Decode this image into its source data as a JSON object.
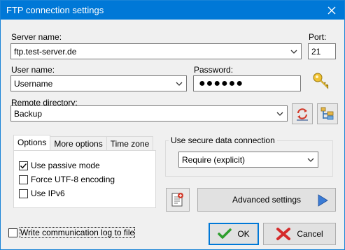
{
  "window": {
    "title": "FTP connection settings"
  },
  "server": {
    "label": "Server name:",
    "value": "ftp.test-server.de",
    "port_label": "Port:",
    "port_value": "21"
  },
  "user": {
    "label": "User name:",
    "value": "Username",
    "password_label": "Password:",
    "password_value": "●●●●●●"
  },
  "remote": {
    "label": "Remote directory:",
    "value": "Backup"
  },
  "tabs": [
    {
      "label": "Options",
      "active": true
    },
    {
      "label": "More options",
      "active": false
    },
    {
      "label": "Time zone",
      "active": false
    }
  ],
  "options": {
    "passive": {
      "label": "Use passive mode",
      "checked": true
    },
    "utf8": {
      "label": "Force UTF-8 encoding",
      "checked": false
    },
    "ipv6": {
      "label": "Use IPv6",
      "checked": false
    }
  },
  "secure": {
    "label": "Use secure data connection",
    "value": "Require (explicit)"
  },
  "advanced": {
    "label": "Advanced settings"
  },
  "log": {
    "label": "Write communication log to file",
    "checked": false
  },
  "actions": {
    "ok": "OK",
    "cancel": "Cancel"
  },
  "colors": {
    "titlebar": "#0078d7",
    "accent": "#0078d7",
    "ok_check": "#2e9e2e",
    "cancel_x": "#d52b2b"
  },
  "icons": {
    "key": "key-icon",
    "sync": "sync-icon",
    "tree": "folder-tree-icon",
    "log": "log-file-icon",
    "arrow": "play-arrow-icon"
  }
}
